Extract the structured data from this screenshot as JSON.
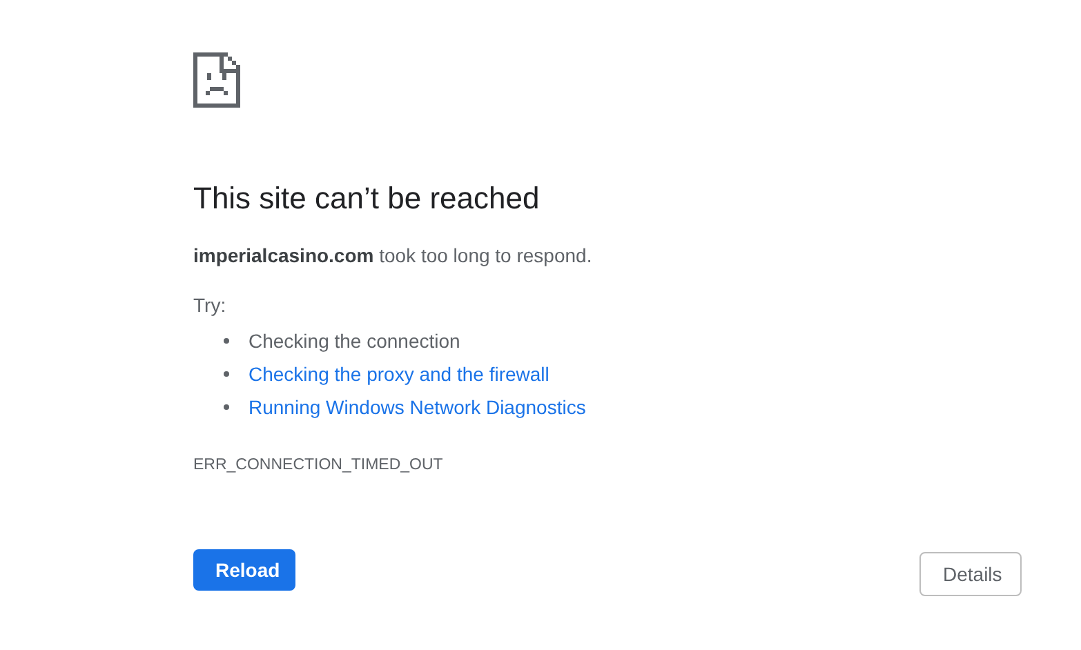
{
  "heading": "This site can’t be reached",
  "summary": "**imperialcasino.com** took too long to respond.",
  "suggestions_label": "Try:",
  "suggestions": [
    {
      "kind": "text",
      "label": "Checking the connection"
    },
    {
      "kind": "link",
      "label": "Checking the proxy and the firewall"
    },
    {
      "kind": "link",
      "label": "Running Windows Network Diagnostics"
    }
  ],
  "error_code": "ERR_CONNECTION_TIMED_OUT",
  "buttons": {
    "primary": "Reload",
    "secondary": "Details"
  }
}
